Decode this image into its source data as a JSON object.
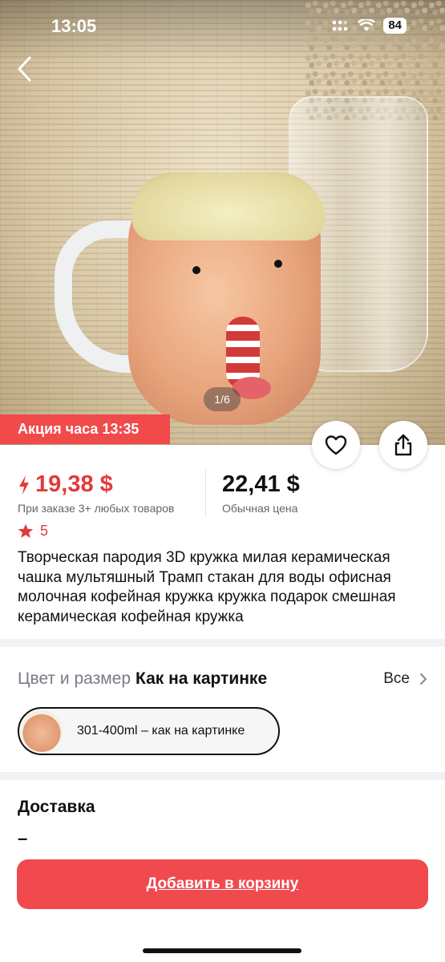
{
  "status_bar": {
    "time": "13:05",
    "battery": "84"
  },
  "gallery": {
    "counter": "1/6"
  },
  "promo": {
    "label": "Акция часа 13:35"
  },
  "price": {
    "sale": "19,38 $",
    "sale_caption": "При заказе 3+ любых товаров",
    "regular": "22,41 $",
    "regular_caption": "Обычная цена"
  },
  "rating": {
    "value": "5"
  },
  "product": {
    "title": "Творческая пародия 3D кружка милая керамическая чашка мультяшный Трамп стакан для воды офисная молочная кофейная кружка кружка подарок смешная керамическая кофейная кружка"
  },
  "variant": {
    "label": "Цвет и размер",
    "value": "Как на картинке",
    "all_label": "Все",
    "chip_label": "301-400ml – как на картинке"
  },
  "delivery": {
    "title": "Доставка",
    "value": "–"
  },
  "cart": {
    "button_label": "Добавить в корзину"
  },
  "colors": {
    "accent": "#f04a4f",
    "price_red": "#e23a3a"
  }
}
